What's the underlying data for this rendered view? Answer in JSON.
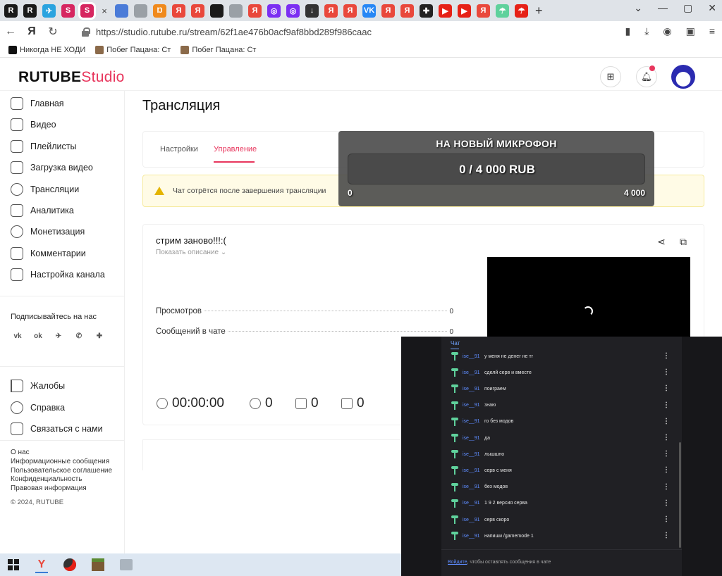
{
  "browser": {
    "tabs": [
      {
        "glyph": "R",
        "color": "#1a1a1a"
      },
      {
        "glyph": "R",
        "color": "#1a1a1a"
      },
      {
        "glyph": "✈",
        "color": "#2aa3df"
      },
      {
        "glyph": "S",
        "color": "#d62660"
      },
      {
        "glyph": "S",
        "color": "#d62660",
        "active": true
      },
      {
        "glyph": "",
        "color": "#4a7bd8"
      },
      {
        "glyph": "",
        "color": "#9aa0a6"
      },
      {
        "glyph": "Ŋ",
        "color": "#f08a1d"
      },
      {
        "glyph": "Я",
        "color": "#e9483c"
      },
      {
        "glyph": "Я",
        "color": "#e9483c"
      },
      {
        "glyph": "",
        "color": "#1a1a1a"
      },
      {
        "glyph": "",
        "color": "#9aa0a6"
      },
      {
        "glyph": "Я",
        "color": "#e9483c"
      },
      {
        "glyph": "◎",
        "color": "#7b2ff2"
      },
      {
        "glyph": "◎",
        "color": "#7b2ff2"
      },
      {
        "glyph": "↓",
        "color": "#333333"
      },
      {
        "glyph": "Я",
        "color": "#e9483c"
      },
      {
        "glyph": "Я",
        "color": "#e9483c"
      },
      {
        "glyph": "VK",
        "color": "#2787f5"
      },
      {
        "glyph": "Я",
        "color": "#e9483c"
      },
      {
        "glyph": "Я",
        "color": "#e9483c"
      },
      {
        "glyph": "✚",
        "color": "#222222"
      },
      {
        "glyph": "▶",
        "color": "#e62117"
      },
      {
        "glyph": "▶",
        "color": "#e62117"
      },
      {
        "glyph": "Я",
        "color": "#e9483c"
      },
      {
        "glyph": "☂",
        "color": "#5fd19c"
      },
      {
        "glyph": "☂",
        "color": "#e62117"
      }
    ],
    "active_tab_close": "×",
    "new_tab": "+",
    "window_controls": [
      "⌄",
      "—",
      "▢",
      "✕"
    ],
    "url": "https://studio.rutube.ru/stream/62f1ae476b0acf9af8bbd289f986caac",
    "nav": {
      "back": "←",
      "reload": "↻"
    },
    "bookmarks": [
      {
        "label": "Никогда НЕ ХОДИ",
        "color": "#e9483c"
      },
      {
        "label": "Побег Пацана: Ст",
        "color": "#8b6a4a"
      },
      {
        "label": "Побег Пацана: Ст",
        "color": "#8b6a4a"
      }
    ]
  },
  "header": {
    "logo_main": "RUTUBE",
    "logo_sub": "Studio",
    "accent": "#e8365d"
  },
  "sidebar": {
    "items": [
      {
        "label": "Главная"
      },
      {
        "label": "Видео"
      },
      {
        "label": "Плейлисты"
      },
      {
        "label": "Загрузка видео"
      },
      {
        "label": "Трансляции"
      },
      {
        "label": "Аналитика"
      },
      {
        "label": "Монетизация"
      },
      {
        "label": "Комментарии"
      },
      {
        "label": "Настройка канала"
      }
    ],
    "follow_title": "Подписывайтесь на нас",
    "socials": [
      "vk",
      "ok",
      "telegram",
      "viber",
      "more"
    ],
    "help_items": [
      {
        "label": "Жалобы"
      },
      {
        "label": "Справка"
      },
      {
        "label": "Связаться с нами"
      }
    ],
    "footer_links": [
      "О нас",
      "Информационные сообщения",
      "Пользовательское соглашение",
      "Конфиденциальность",
      "Правовая информация"
    ],
    "copyright": "© 2024, RUTUBE"
  },
  "main": {
    "title": "Трансляция",
    "tabs": [
      "Настройки",
      "Управление"
    ],
    "active_tab": 1,
    "warning": "Чат сотрётся после завершения трансляции",
    "stream_title": "стрим заново!!!:(",
    "show_description": "Показать описание",
    "stats": [
      {
        "label": "Просмотров",
        "value": "0"
      },
      {
        "label": "Сообщений в чате",
        "value": "0"
      }
    ],
    "metrics": {
      "duration": "00:00:00",
      "viewers": "0",
      "likes": "0",
      "dislikes": "0"
    }
  },
  "donation": {
    "title": "НА НОВЫЙ МИКРОФОН",
    "progress": "0 / 4 000 RUB",
    "min": "0",
    "max": "4 000",
    "fraction": 0
  },
  "chat": {
    "header": "Чат",
    "messages": [
      {
        "user": "ise__91",
        "text": "у меня не денег не тг"
      },
      {
        "user": "ise__91",
        "text": "сделй серв и вместе"
      },
      {
        "user": "ise__91",
        "text": "поиграем"
      },
      {
        "user": "ise__91",
        "text": "знаю"
      },
      {
        "user": "ise__91",
        "text": "го без модов"
      },
      {
        "user": "ise__91",
        "text": "да"
      },
      {
        "user": "ise__91",
        "text": "лышшно"
      },
      {
        "user": "ise__91",
        "text": "серв с меня"
      },
      {
        "user": "ise__91",
        "text": "без модов"
      },
      {
        "user": "ise__91",
        "text": "1 9 2 версия серва"
      },
      {
        "user": "ise__91",
        "text": "серв скоро"
      },
      {
        "user": "ise__91",
        "text": "напиши /gamemode 1"
      }
    ],
    "login_link": "Войдите",
    "login_rest": ", чтобы оставлять сообщения в чате"
  }
}
